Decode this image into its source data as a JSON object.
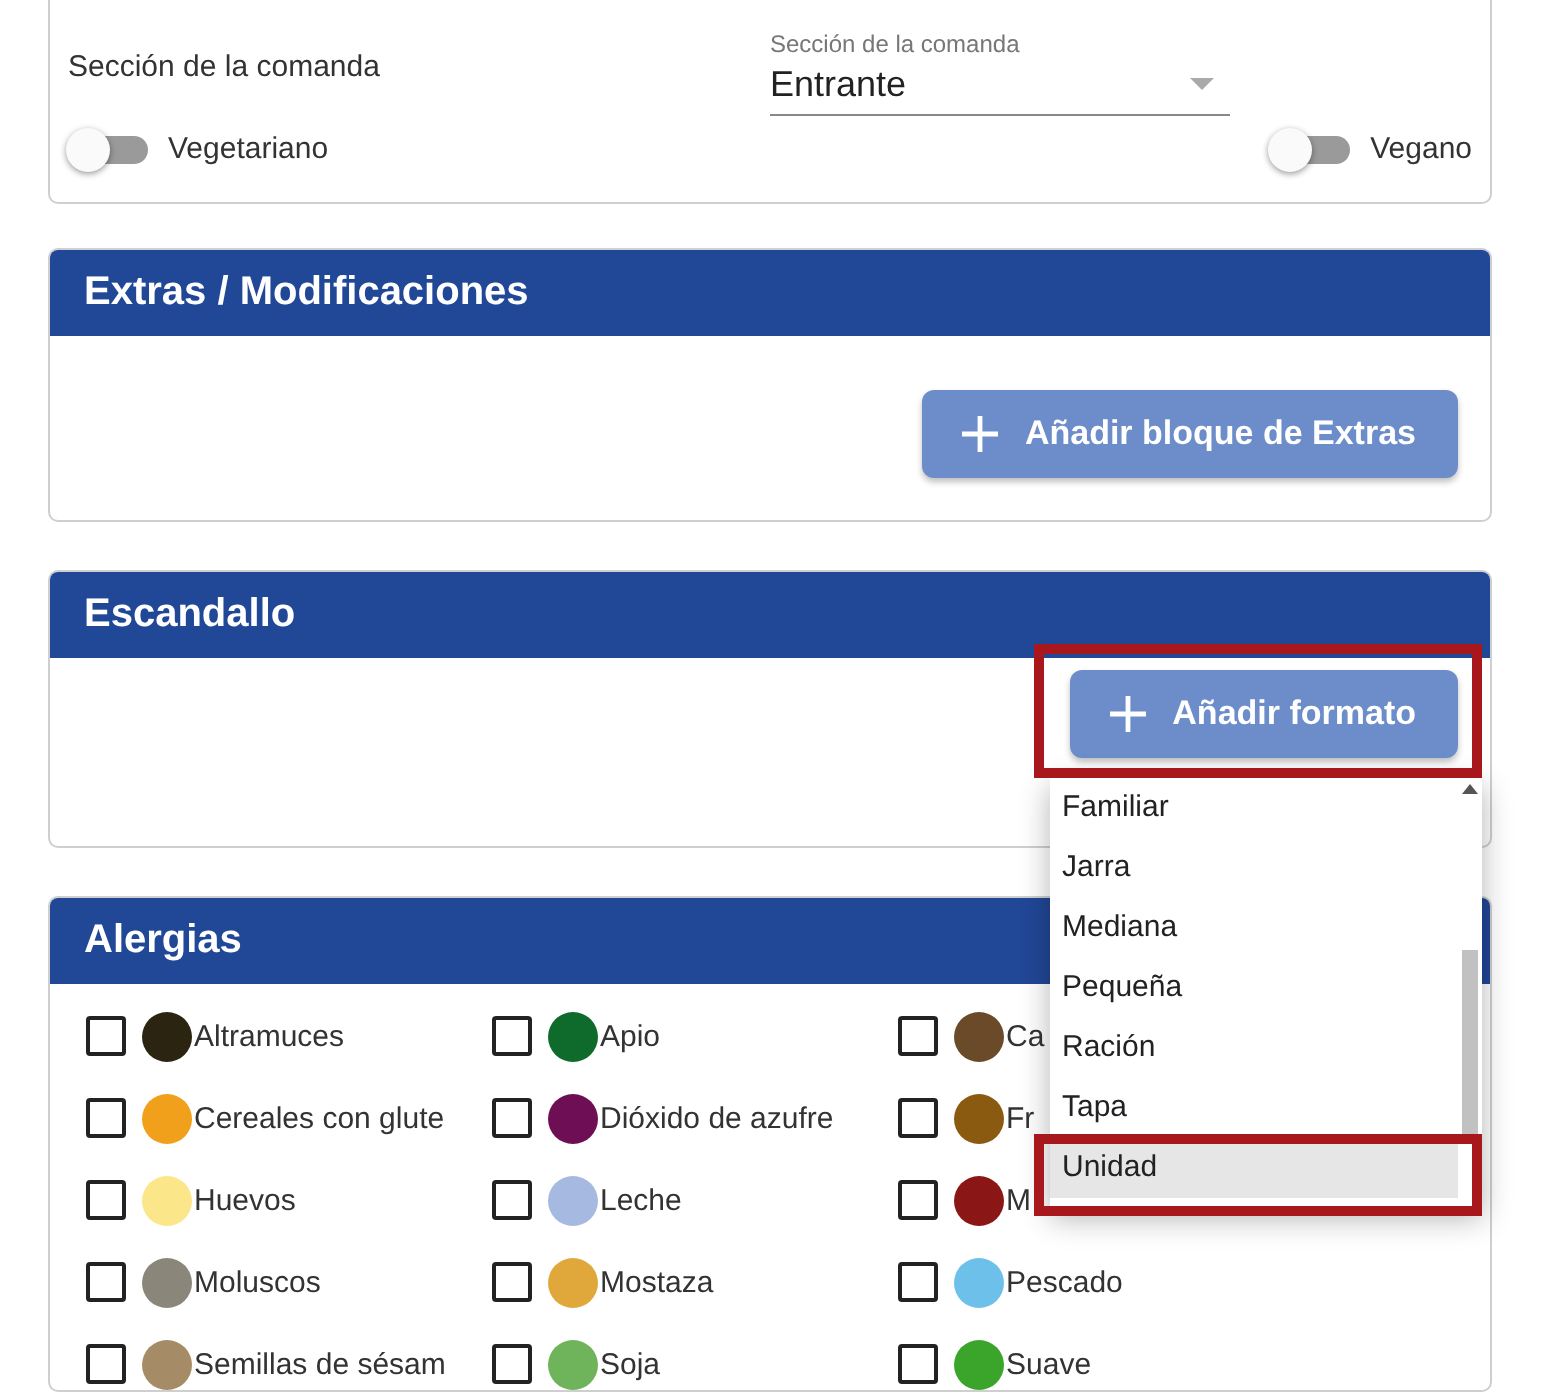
{
  "top_card": {
    "section_label": "Sección de la comanda",
    "select": {
      "label": "Sección de la comanda",
      "value": "Entrante"
    },
    "toggles": [
      {
        "label": "Vegetariano",
        "on": false
      },
      {
        "label": "Vegano",
        "on": false
      }
    ]
  },
  "extras": {
    "title": "Extras / Modificaciones",
    "button": "Añadir bloque de Extras"
  },
  "escandallo": {
    "title": "Escandallo",
    "button": "Añadir formato"
  },
  "format_menu": {
    "items": [
      {
        "label": "Familiar",
        "selected": false
      },
      {
        "label": "Jarra",
        "selected": false
      },
      {
        "label": "Mediana",
        "selected": false
      },
      {
        "label": "Pequeña",
        "selected": false
      },
      {
        "label": "Ración",
        "selected": false
      },
      {
        "label": "Tapa",
        "selected": false
      },
      {
        "label": "Unidad",
        "selected": true
      }
    ]
  },
  "alergias": {
    "title": "Alergias",
    "items": [
      {
        "label": "Altramuces",
        "checked": false,
        "color": "#2b2410"
      },
      {
        "label": "Apio",
        "checked": false,
        "color": "#0f6b2c"
      },
      {
        "label": "Ca",
        "checked": false,
        "color": "#6b4a2a"
      },
      {
        "label": "Cereales con glute",
        "checked": false,
        "color": "#f0a01a"
      },
      {
        "label": "Dióxido de azufre",
        "checked": false,
        "color": "#6e0f56"
      },
      {
        "label": "Fr",
        "checked": false,
        "color": "#8a5a10"
      },
      {
        "label": "Huevos",
        "checked": false,
        "color": "#fbe68a"
      },
      {
        "label": "Leche",
        "checked": false,
        "color": "#a6b9e0"
      },
      {
        "label": "M",
        "checked": false,
        "color": "#8a1616"
      },
      {
        "label": "Moluscos",
        "checked": false,
        "color": "#8a867a"
      },
      {
        "label": "Mostaza",
        "checked": false,
        "color": "#e0a83a"
      },
      {
        "label": "Pescado",
        "checked": false,
        "color": "#6cc0ea"
      },
      {
        "label": "Semillas de sésam",
        "checked": false,
        "color": "#a68c66"
      },
      {
        "label": "Soja",
        "checked": false,
        "color": "#6fb35a"
      },
      {
        "label": "Suave",
        "checked": false,
        "color": "#3aa52a"
      }
    ]
  }
}
